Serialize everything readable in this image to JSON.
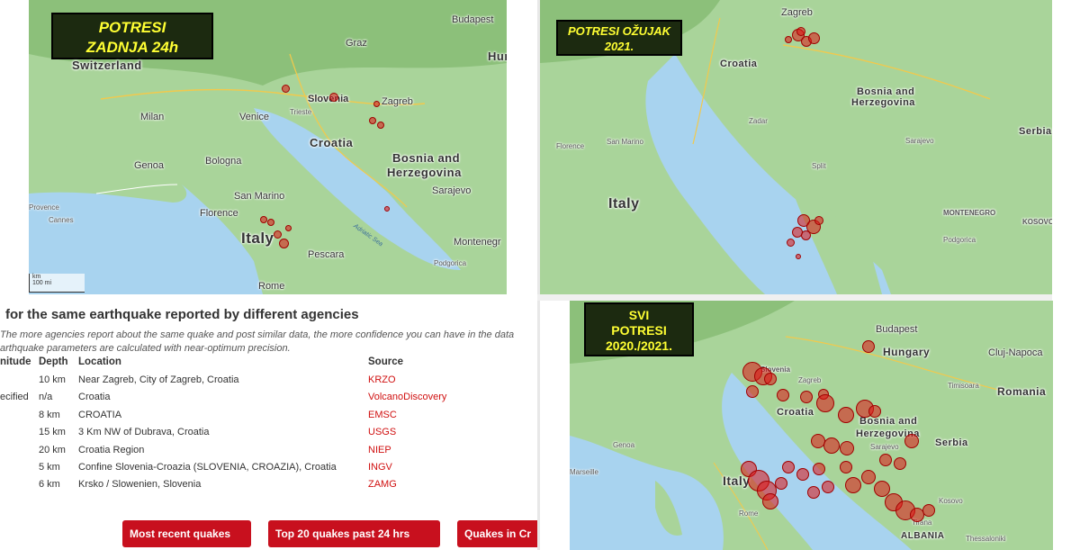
{
  "map1": {
    "badge": [
      "POTRESI",
      "ZADNJA 24h"
    ],
    "labels": {
      "switzerland": "Switzerland",
      "budapest": "Budapest",
      "graz": "Graz",
      "hunga": "Hunga",
      "slovenia": "Slovenia",
      "zagreb": "Zagreb",
      "milan": "Milan",
      "venice": "Venice",
      "trieste": "Trieste",
      "croatia": "Croatia",
      "genoa": "Genoa",
      "bologna": "Bologna",
      "bosnia": "Bosnia and",
      "herzegovina": "Herzegovina",
      "sarajevo": "Sarajevo",
      "san_marino": "San Marino",
      "florence": "Florence",
      "provence": "Provence",
      "cannes": "Cannes",
      "italy": "Italy",
      "adriatic": "Adriatic Sea",
      "montenegro": "Montenegr",
      "pescara": "Pescara",
      "podgorica": "Podgorica",
      "rome": "Rome",
      "scale_km": "km",
      "scale_mi": "100 mi"
    }
  },
  "map2": {
    "badge": [
      "POTRESI OŽUJAK",
      "2021."
    ],
    "labels": {
      "zagreb": "Zagreb",
      "croatia": "Croatia",
      "bosnia": "Bosnia and",
      "herzegovina": "Herzegovina",
      "serbia": "Serbia",
      "florence": "Florence",
      "san_marino": "San Marino",
      "italy": "Italy",
      "sarajevo": "Sarajevo",
      "montenegro": "MONTENEGRO",
      "kosovo": "KOSOVO",
      "podgorica": "Podgorica",
      "split": "Split",
      "zadar": "Zadar"
    }
  },
  "map3": {
    "badge": [
      "SVI",
      "POTRESI",
      "2020./2021."
    ],
    "labels": {
      "budapest": "Budapest",
      "hungary": "Hungary",
      "cluj": "Cluj-Napoca",
      "romania": "Romania",
      "slovenia": "Slovenia",
      "zagreb": "Zagreb",
      "croatia": "Croatia",
      "bosnia": "Bosnia and",
      "herzegovina": "Herzegovina",
      "serbia": "Serbia",
      "sarajevo": "Sarajevo",
      "italy": "Italy",
      "rome": "Rome",
      "kosovo": "Kosovo",
      "tirana": "Tirana",
      "albania": "ALBANIA",
      "marseille": "Marseille",
      "genoa": "Genoa",
      "timisoara": "Timisoara",
      "thessaloniki": "Thessaloniki"
    }
  },
  "panel": {
    "title": "for the same earthquake reported by different agencies",
    "desc1": "The more agencies report about the same quake and post similar data, the more confidence you can have in the data",
    "desc2": "arthquake parameters are calculated with near-optimum precision.",
    "headers": {
      "magnitude": "nitude",
      "depth": "Depth",
      "location": "Location",
      "source": "Source"
    },
    "rows": [
      {
        "mag": "",
        "depth": "10 km",
        "location": "Near Zagreb, City of Zagreb, Croatia",
        "source": "KRZO"
      },
      {
        "mag": "ecified",
        "depth": "n/a",
        "location": "Croatia",
        "source": "VolcanoDiscovery"
      },
      {
        "mag": "",
        "depth": "8 km",
        "location": "CROATIA",
        "source": "EMSC"
      },
      {
        "mag": "",
        "depth": "15 km",
        "location": "3 Km NW of Dubrava, Croatia",
        "source": "USGS"
      },
      {
        "mag": "",
        "depth": "20 km",
        "location": "Croatia Region",
        "source": "NIEP"
      },
      {
        "mag": "",
        "depth": "5 km",
        "location": "Confine Slovenia-Croazia (SLOVENIA, CROAZIA), Croatia",
        "source": "INGV"
      },
      {
        "mag": "",
        "depth": "6 km",
        "location": "Krsko / Slowenien, Slovenia",
        "source": "ZAMG"
      }
    ],
    "buttons": [
      "Most recent quakes",
      "Top 20 quakes past 24 hrs",
      "Quakes in Cr"
    ]
  },
  "colors": {
    "land": "#a9d49a",
    "mountain": "#8cc07a",
    "sea": "#a8d3ef",
    "quake": "#dc1414",
    "badge_bg": "#1c2a10",
    "badge_text": "#ffff33",
    "button": "#c8101e"
  }
}
